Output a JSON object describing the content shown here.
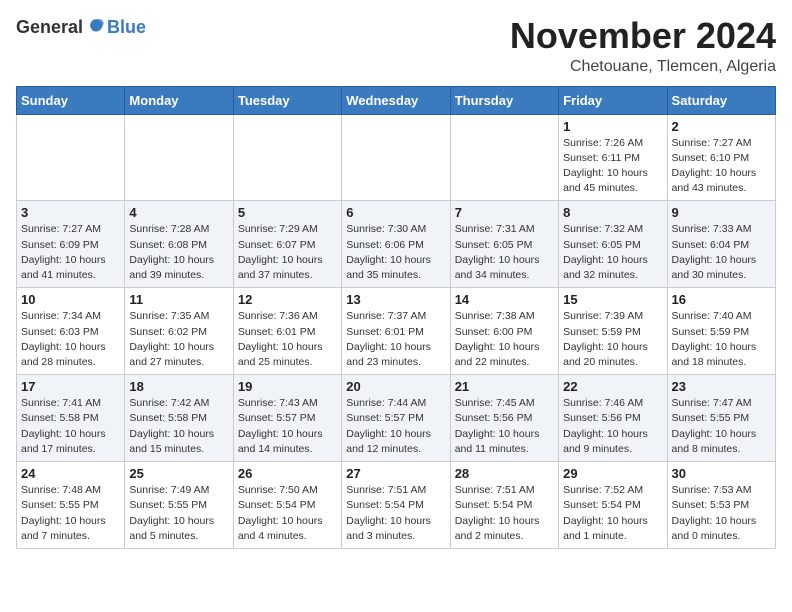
{
  "header": {
    "logo_general": "General",
    "logo_blue": "Blue",
    "month_title": "November 2024",
    "location": "Chetouane, Tlemcen, Algeria"
  },
  "days_of_week": [
    "Sunday",
    "Monday",
    "Tuesday",
    "Wednesday",
    "Thursday",
    "Friday",
    "Saturday"
  ],
  "weeks": [
    [
      {
        "day": "",
        "sunrise": "",
        "sunset": "",
        "daylight": ""
      },
      {
        "day": "",
        "sunrise": "",
        "sunset": "",
        "daylight": ""
      },
      {
        "day": "",
        "sunrise": "",
        "sunset": "",
        "daylight": ""
      },
      {
        "day": "",
        "sunrise": "",
        "sunset": "",
        "daylight": ""
      },
      {
        "day": "",
        "sunrise": "",
        "sunset": "",
        "daylight": ""
      },
      {
        "day": "1",
        "sunrise": "Sunrise: 7:26 AM",
        "sunset": "Sunset: 6:11 PM",
        "daylight": "Daylight: 10 hours and 45 minutes."
      },
      {
        "day": "2",
        "sunrise": "Sunrise: 7:27 AM",
        "sunset": "Sunset: 6:10 PM",
        "daylight": "Daylight: 10 hours and 43 minutes."
      }
    ],
    [
      {
        "day": "3",
        "sunrise": "Sunrise: 7:27 AM",
        "sunset": "Sunset: 6:09 PM",
        "daylight": "Daylight: 10 hours and 41 minutes."
      },
      {
        "day": "4",
        "sunrise": "Sunrise: 7:28 AM",
        "sunset": "Sunset: 6:08 PM",
        "daylight": "Daylight: 10 hours and 39 minutes."
      },
      {
        "day": "5",
        "sunrise": "Sunrise: 7:29 AM",
        "sunset": "Sunset: 6:07 PM",
        "daylight": "Daylight: 10 hours and 37 minutes."
      },
      {
        "day": "6",
        "sunrise": "Sunrise: 7:30 AM",
        "sunset": "Sunset: 6:06 PM",
        "daylight": "Daylight: 10 hours and 35 minutes."
      },
      {
        "day": "7",
        "sunrise": "Sunrise: 7:31 AM",
        "sunset": "Sunset: 6:05 PM",
        "daylight": "Daylight: 10 hours and 34 minutes."
      },
      {
        "day": "8",
        "sunrise": "Sunrise: 7:32 AM",
        "sunset": "Sunset: 6:05 PM",
        "daylight": "Daylight: 10 hours and 32 minutes."
      },
      {
        "day": "9",
        "sunrise": "Sunrise: 7:33 AM",
        "sunset": "Sunset: 6:04 PM",
        "daylight": "Daylight: 10 hours and 30 minutes."
      }
    ],
    [
      {
        "day": "10",
        "sunrise": "Sunrise: 7:34 AM",
        "sunset": "Sunset: 6:03 PM",
        "daylight": "Daylight: 10 hours and 28 minutes."
      },
      {
        "day": "11",
        "sunrise": "Sunrise: 7:35 AM",
        "sunset": "Sunset: 6:02 PM",
        "daylight": "Daylight: 10 hours and 27 minutes."
      },
      {
        "day": "12",
        "sunrise": "Sunrise: 7:36 AM",
        "sunset": "Sunset: 6:01 PM",
        "daylight": "Daylight: 10 hours and 25 minutes."
      },
      {
        "day": "13",
        "sunrise": "Sunrise: 7:37 AM",
        "sunset": "Sunset: 6:01 PM",
        "daylight": "Daylight: 10 hours and 23 minutes."
      },
      {
        "day": "14",
        "sunrise": "Sunrise: 7:38 AM",
        "sunset": "Sunset: 6:00 PM",
        "daylight": "Daylight: 10 hours and 22 minutes."
      },
      {
        "day": "15",
        "sunrise": "Sunrise: 7:39 AM",
        "sunset": "Sunset: 5:59 PM",
        "daylight": "Daylight: 10 hours and 20 minutes."
      },
      {
        "day": "16",
        "sunrise": "Sunrise: 7:40 AM",
        "sunset": "Sunset: 5:59 PM",
        "daylight": "Daylight: 10 hours and 18 minutes."
      }
    ],
    [
      {
        "day": "17",
        "sunrise": "Sunrise: 7:41 AM",
        "sunset": "Sunset: 5:58 PM",
        "daylight": "Daylight: 10 hours and 17 minutes."
      },
      {
        "day": "18",
        "sunrise": "Sunrise: 7:42 AM",
        "sunset": "Sunset: 5:58 PM",
        "daylight": "Daylight: 10 hours and 15 minutes."
      },
      {
        "day": "19",
        "sunrise": "Sunrise: 7:43 AM",
        "sunset": "Sunset: 5:57 PM",
        "daylight": "Daylight: 10 hours and 14 minutes."
      },
      {
        "day": "20",
        "sunrise": "Sunrise: 7:44 AM",
        "sunset": "Sunset: 5:57 PM",
        "daylight": "Daylight: 10 hours and 12 minutes."
      },
      {
        "day": "21",
        "sunrise": "Sunrise: 7:45 AM",
        "sunset": "Sunset: 5:56 PM",
        "daylight": "Daylight: 10 hours and 11 minutes."
      },
      {
        "day": "22",
        "sunrise": "Sunrise: 7:46 AM",
        "sunset": "Sunset: 5:56 PM",
        "daylight": "Daylight: 10 hours and 9 minutes."
      },
      {
        "day": "23",
        "sunrise": "Sunrise: 7:47 AM",
        "sunset": "Sunset: 5:55 PM",
        "daylight": "Daylight: 10 hours and 8 minutes."
      }
    ],
    [
      {
        "day": "24",
        "sunrise": "Sunrise: 7:48 AM",
        "sunset": "Sunset: 5:55 PM",
        "daylight": "Daylight: 10 hours and 7 minutes."
      },
      {
        "day": "25",
        "sunrise": "Sunrise: 7:49 AM",
        "sunset": "Sunset: 5:55 PM",
        "daylight": "Daylight: 10 hours and 5 minutes."
      },
      {
        "day": "26",
        "sunrise": "Sunrise: 7:50 AM",
        "sunset": "Sunset: 5:54 PM",
        "daylight": "Daylight: 10 hours and 4 minutes."
      },
      {
        "day": "27",
        "sunrise": "Sunrise: 7:51 AM",
        "sunset": "Sunset: 5:54 PM",
        "daylight": "Daylight: 10 hours and 3 minutes."
      },
      {
        "day": "28",
        "sunrise": "Sunrise: 7:51 AM",
        "sunset": "Sunset: 5:54 PM",
        "daylight": "Daylight: 10 hours and 2 minutes."
      },
      {
        "day": "29",
        "sunrise": "Sunrise: 7:52 AM",
        "sunset": "Sunset: 5:54 PM",
        "daylight": "Daylight: 10 hours and 1 minute."
      },
      {
        "day": "30",
        "sunrise": "Sunrise: 7:53 AM",
        "sunset": "Sunset: 5:53 PM",
        "daylight": "Daylight: 10 hours and 0 minutes."
      }
    ]
  ]
}
